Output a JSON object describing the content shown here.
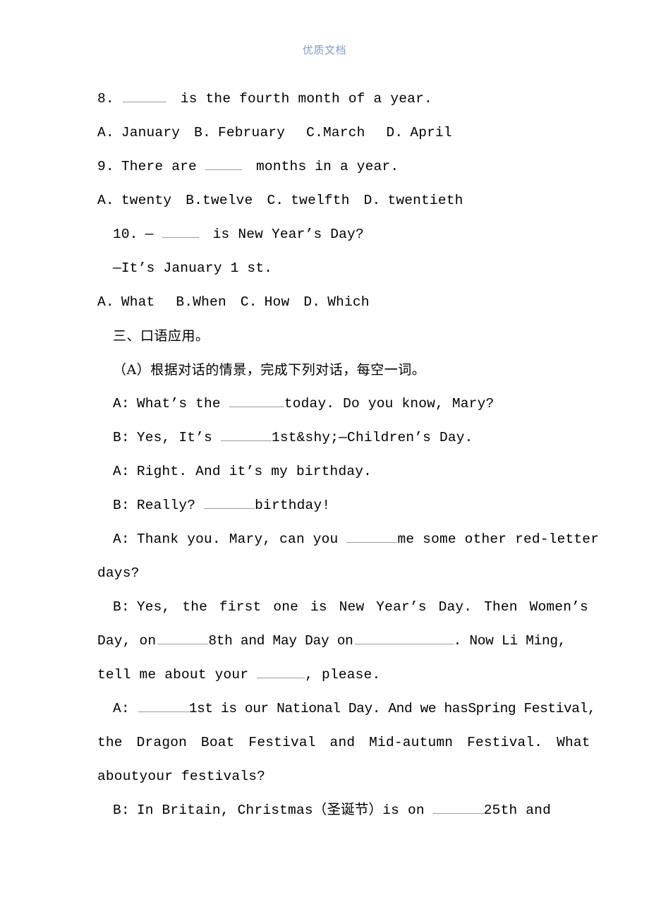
{
  "header": {
    "watermark_text": "优质文档",
    "watermark_color": "#7e9fc2"
  },
  "document": {
    "page_background": "#ffffff",
    "text_color": "#000000",
    "blank_rule_color": "#9a9a9a"
  },
  "questions": [
    {
      "number": "8.",
      "stem_before": "",
      "stem_after": "is the fourth month of a year.",
      "options": [
        {
          "letter": "A.",
          "text": "January"
        },
        {
          "letter": "B.",
          "text": "February"
        },
        {
          "letter": "C.",
          "text": "March"
        },
        {
          "letter": "D.",
          "text": "April"
        }
      ],
      "options_line": "A. January  B. February    C.March    D. April"
    },
    {
      "number": "9.",
      "stem_before": "There are",
      "stem_after": "months in a year.",
      "options": [
        {
          "letter": "A.",
          "text": "twenty"
        },
        {
          "letter": "B.",
          "text": "twelve"
        },
        {
          "letter": "C.",
          "text": "twelfth"
        },
        {
          "letter": "D.",
          "text": "twentieth"
        }
      ],
      "options_line": "A. twenty  B.twelve  C. twelfth  D. twentieth"
    },
    {
      "number": "10.",
      "stem_before": "—",
      "stem_after": "is New Year’s Day?",
      "answer_line": "—It’s January 1 st.",
      "options": [
        {
          "letter": "A.",
          "text": "What"
        },
        {
          "letter": "B.",
          "text": "When"
        },
        {
          "letter": "C.",
          "text": "How"
        },
        {
          "letter": "D.",
          "text": "Which"
        }
      ],
      "options_line": "A. What  B.When  C. How  D. Which"
    }
  ],
  "section": {
    "heading": "三、口语应用。",
    "subheading": "（A）根据对话的情景，完成下列对话，每空一词。"
  },
  "dialogue": [
    {
      "speaker": "A:",
      "part1": "What’s the",
      "part2": "today. Do you know, Mary?"
    },
    {
      "speaker": "B:",
      "part1": "Yes, It’s",
      "part2": "1st&shy;—Children’s Day."
    },
    {
      "speaker": "A:",
      "part1": "Right. And it’s my birthday.",
      "part2": ""
    },
    {
      "speaker": "B:",
      "part1": "Really?",
      "part2": "birthday!"
    },
    {
      "speaker": "A:",
      "part1": "Thank you. Mary, can you",
      "part2": "me some other red-letter days?"
    },
    {
      "speaker": "B:",
      "part1": "Yes, the first one is New Year’s Day. Then Women’s Day, on",
      "part2": "8th and May Day on",
      "part3": ". Now Li Ming, tell me about your",
      "part4": ", please."
    },
    {
      "speaker": "A:",
      "part1": "",
      "part2": "1st is our National Day. And we hasSpring Festival, the Dragon Boat Festival and Mid-autumn Festival. What aboutyour festivals?"
    },
    {
      "speaker": "B:",
      "part1": "In Britain, Christmas（圣诞节）is on",
      "part2": "25th and"
    }
  ],
  "fragments": {
    "q8_number": "8.",
    "q8_after": "is the fourth month of a year.",
    "q9_number": "9.",
    "q9_before": "There are",
    "q9_after": "months in a year.",
    "q10_number": "10.",
    "q10_dash": "—",
    "q10_after": "is New Year’s Day?",
    "q10_answer": "—It’s January 1 st.",
    "d1_speaker": "A:",
    "d1_a": "What’s the",
    "d1_b": "today. Do you know, Mary?",
    "d2_speaker": "B:",
    "d2_a": "Yes, It’s",
    "d2_b": "1st&shy;—Children’s Day.",
    "d3_speaker": "A:",
    "d3_a": "Right. And it’s my birthday.",
    "d4_speaker": "B:",
    "d4_a": "Really?",
    "d4_b": "birthday!",
    "d5_speaker": "A:",
    "d5_a": "Thank you. Mary, can you",
    "d5_b": "me some other red-letter",
    "d5_c": "days?",
    "d6_speaker": "B:",
    "d6_a": "Yes, the first one is New Year’s Day. Then Women’s",
    "d6_b": "Day, on",
    "d6_c": "8th and May Day on",
    "d6_d": ". Now Li Ming,",
    "d6_e": "tell me about your",
    "d6_f": ", please.",
    "d7_speaker": "A:",
    "d7_a": "1st is our National Day. And we hasSpring Festival,",
    "d7_b": "the Dragon Boat Festival and Mid-autumn Festival. What",
    "d7_c": "aboutyour festivals?",
    "d8_speaker": "B:",
    "d8_a": "In Britain, Christmas（圣诞节）is on",
    "d8_b": "25th and"
  }
}
